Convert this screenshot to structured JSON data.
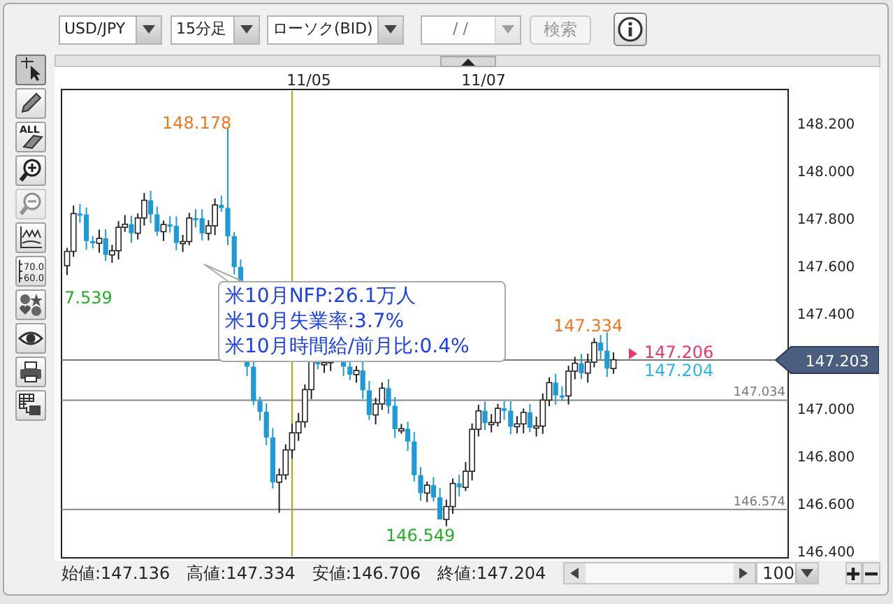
{
  "toolbar": {
    "symbol": "USD/JPY",
    "timeframe": "15分足",
    "chart_type": "ローソク(BID)",
    "date": "/  /",
    "search_button": "検索",
    "search_disabled": true
  },
  "tools": [
    {
      "kind": "pointer",
      "selected": true,
      "disabled": false
    },
    {
      "kind": "pencil",
      "selected": false,
      "disabled": false
    },
    {
      "kind": "erase-all",
      "label": "ALL",
      "selected": false,
      "disabled": false
    },
    {
      "kind": "zoom-in",
      "selected": false,
      "disabled": false
    },
    {
      "kind": "zoom-out",
      "selected": false,
      "disabled": true
    },
    {
      "kind": "indicator",
      "selected": false,
      "disabled": false
    },
    {
      "kind": "values",
      "lines": [
        "70.0",
        "60.0"
      ],
      "selected": false,
      "disabled": false
    },
    {
      "kind": "symbols",
      "selected": false,
      "disabled": false
    },
    {
      "kind": "eye",
      "selected": false,
      "disabled": false
    },
    {
      "kind": "print",
      "selected": false,
      "disabled": false
    },
    {
      "kind": "save",
      "selected": false,
      "disabled": false
    }
  ],
  "chart": {
    "date_labels": [
      "11/05",
      "11/07"
    ],
    "price_ticks": [
      "148.200",
      "148.000",
      "147.800",
      "147.600",
      "147.400",
      "147.000",
      "146.800",
      "146.600",
      "146.400"
    ],
    "current_price": "147.203",
    "lines": [
      {
        "label": "147.034"
      },
      {
        "label": "146.574"
      }
    ],
    "annotations": [
      {
        "kind": "high",
        "text": "148.178"
      },
      {
        "kind": "low",
        "text": "7.539"
      },
      {
        "kind": "low",
        "text": "146.549"
      },
      {
        "kind": "high",
        "text": "147.334"
      },
      {
        "kind": "ask",
        "text": "147.206"
      },
      {
        "kind": "bid",
        "text": "147.204"
      }
    ],
    "news_tooltip": [
      "米10月NFP:26.1万人",
      "米10月失業率:3.7%",
      "米10月時間給/前月比:0.4%"
    ]
  },
  "status": {
    "items": [
      "始値:147.136",
      "高値:147.334",
      "安値:146.706",
      "終値:147.204"
    ],
    "zoom": "100"
  }
}
